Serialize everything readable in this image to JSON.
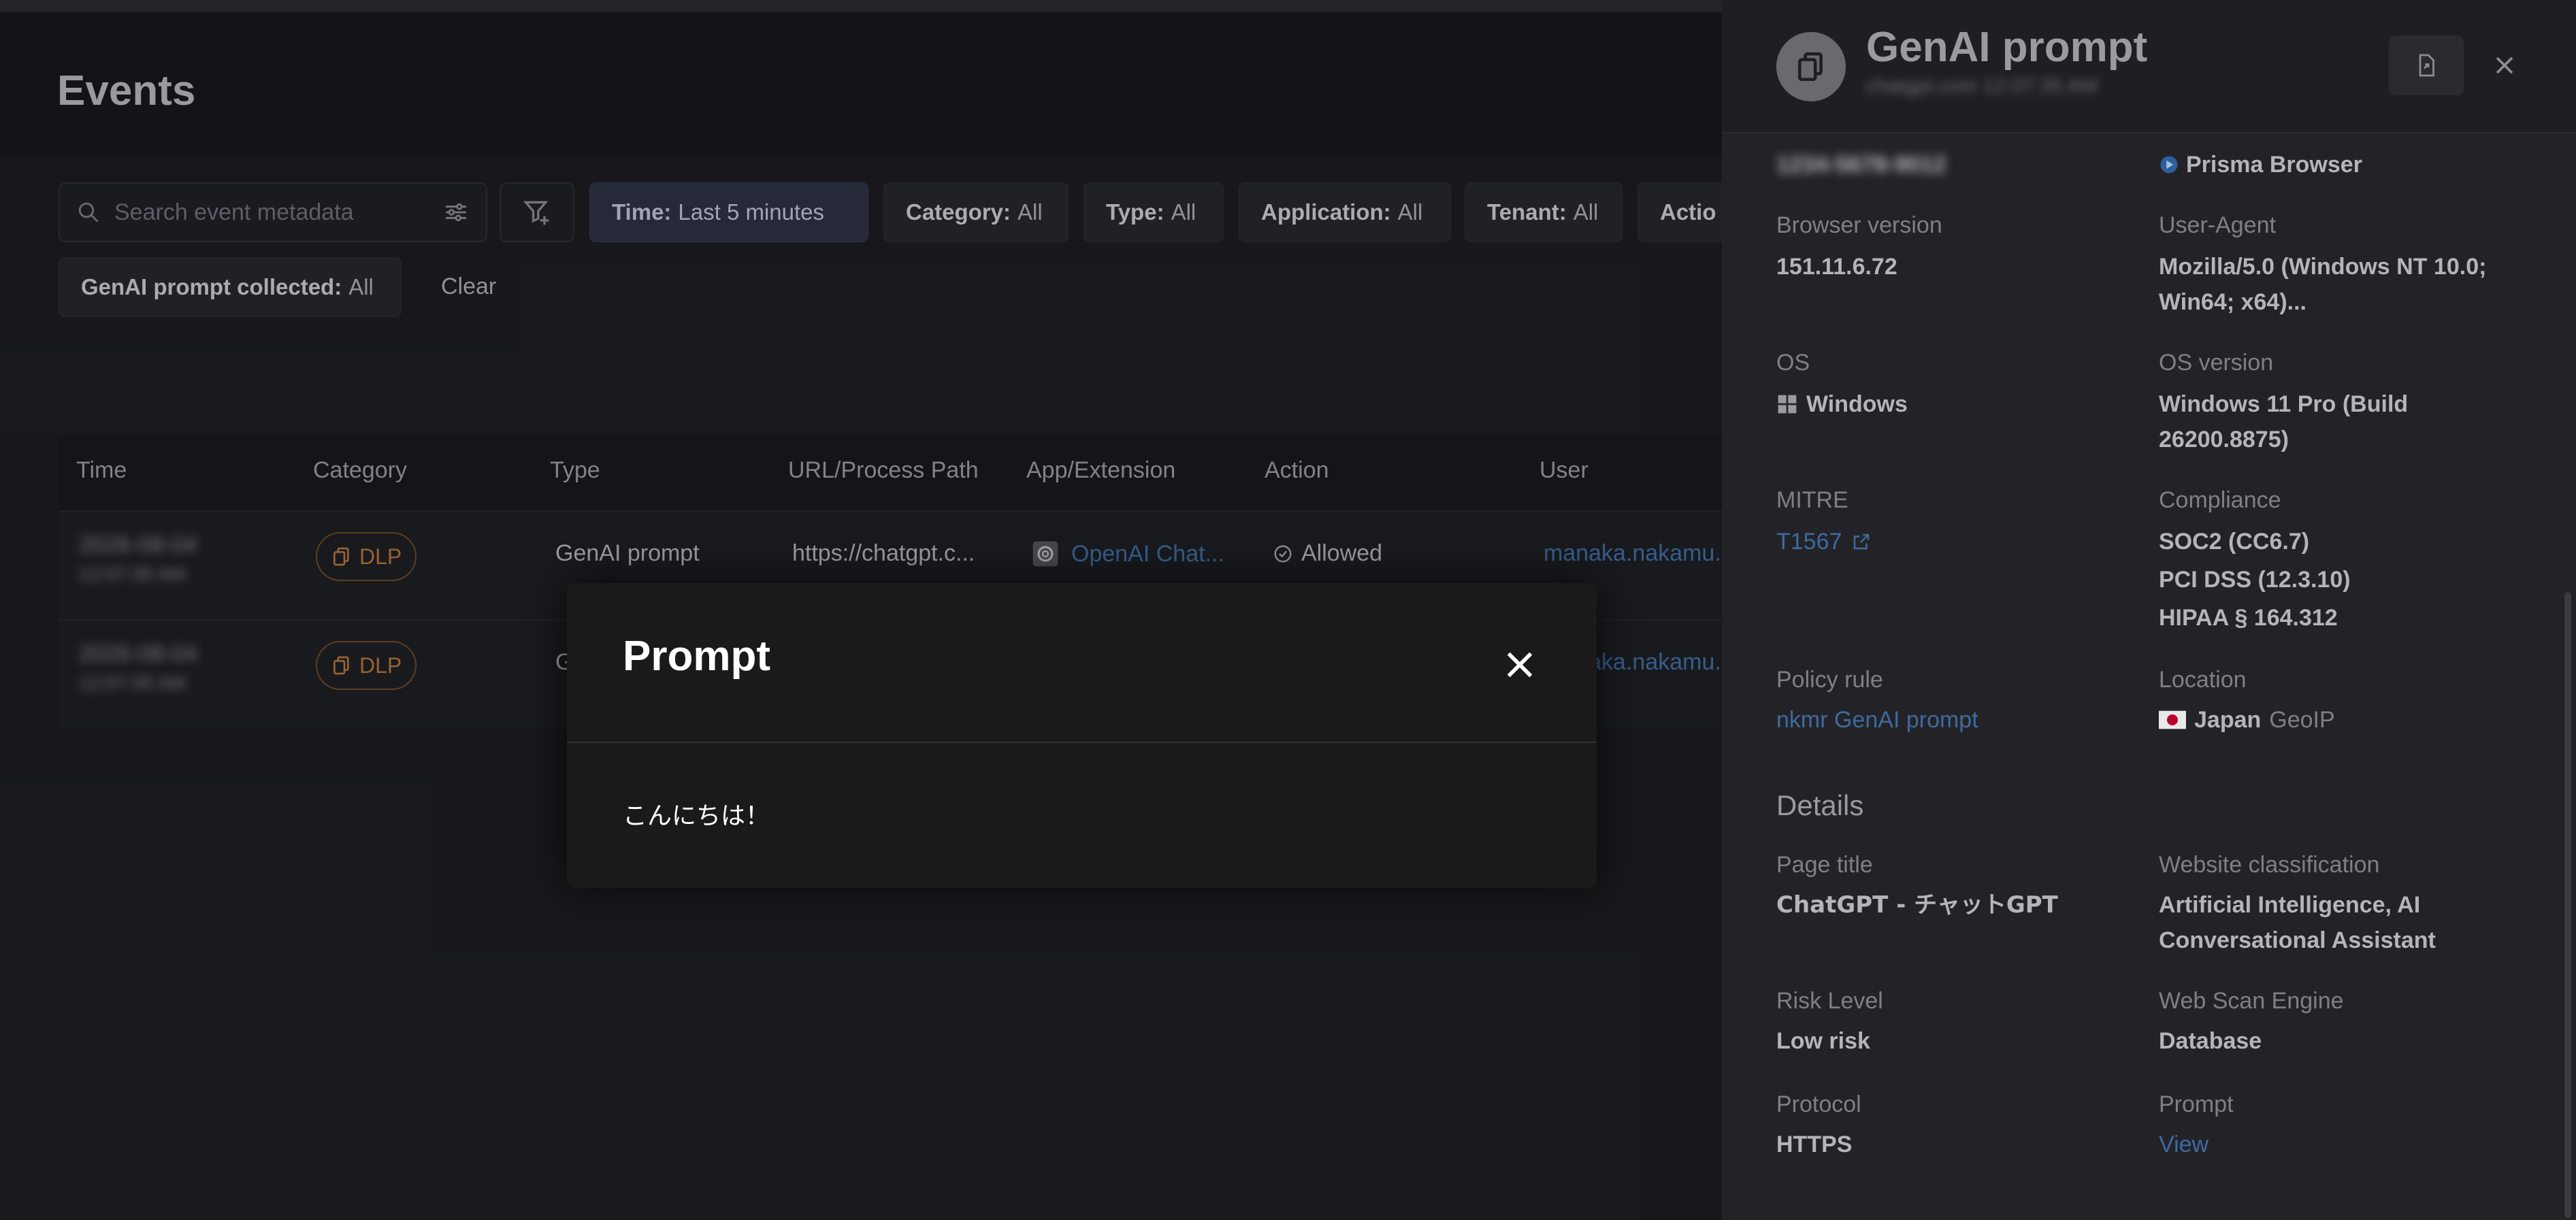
{
  "page": {
    "title": "Events"
  },
  "search": {
    "placeholder": "Search event metadata"
  },
  "filters": {
    "time": {
      "key": "Time:",
      "value": "Last 5 minutes"
    },
    "category": {
      "key": "Category:",
      "value": "All"
    },
    "type": {
      "key": "Type:",
      "value": "All"
    },
    "application": {
      "key": "Application:",
      "value": "All"
    },
    "tenant": {
      "key": "Tenant:",
      "value": "All"
    },
    "action": {
      "key": "Actio"
    },
    "genai": {
      "key": "GenAI prompt collected:",
      "value": "All"
    },
    "clear_label": "Clear"
  },
  "table": {
    "columns": [
      "Time",
      "Category",
      "Type",
      "URL/Process Path",
      "App/Extension",
      "Action",
      "User"
    ],
    "rows": [
      {
        "time": "2026-08-04",
        "time2": "12:07:35 AM",
        "category": "DLP",
        "type": "GenAI prompt",
        "url": "https://chatgpt.c...",
        "app": "OpenAI Chat...",
        "action": "Allowed",
        "user": "manaka.nakamu..."
      },
      {
        "time": "2026-08-04",
        "time2": "12:07:35 AM",
        "category": "DLP",
        "type": "G",
        "user": "manaka.nakamu..."
      }
    ]
  },
  "modal": {
    "title": "Prompt",
    "body": "こんにちは！"
  },
  "panel": {
    "title": "GenAI prompt",
    "subtitle": "chatgpt.com 12:07:35 AM",
    "top_left_blurred": "1234-5678-9012",
    "browser": "Prisma Browser",
    "fields": {
      "browser_version": {
        "label": "Browser version",
        "value": "151.11.6.72"
      },
      "user_agent": {
        "label": "User-Agent",
        "value1": "Mozilla/5.0 (Windows NT 10.0;",
        "value2": "Win64; x64)..."
      },
      "os": {
        "label": "OS",
        "value": "Windows"
      },
      "os_version": {
        "label": "OS version",
        "value1": "Windows 11 Pro (Build",
        "value2": "26200.8875)"
      },
      "mitre": {
        "label": "MITRE",
        "value": "T1567"
      },
      "compliance": {
        "label": "Compliance",
        "v1": "SOC2 (CC6.7)",
        "v2": "PCI DSS (12.3.10)",
        "v3": "HIPAA § 164.312"
      },
      "policy_rule": {
        "label": "Policy rule",
        "value": "nkmr GenAI prompt"
      },
      "location": {
        "label": "Location",
        "value": "Japan",
        "suffix": "GeoIP"
      }
    },
    "details_heading": "Details",
    "details": {
      "page_title": {
        "label": "Page title",
        "value": "ChatGPT - チャットGPT"
      },
      "website_class": {
        "label": "Website classification",
        "value1": "Artificial Intelligence, AI",
        "value2": "Conversational Assistant"
      },
      "risk": {
        "label": "Risk Level",
        "value": "Low risk"
      },
      "scan_engine": {
        "label": "Web Scan Engine",
        "value": "Database"
      },
      "protocol": {
        "label": "Protocol",
        "value": "HTTPS"
      },
      "prompt": {
        "label": "Prompt",
        "value": "View"
      }
    }
  },
  "colors": {
    "accent_link": "#3e6aa0",
    "dlp": "#b7773d",
    "modal_bg": "#1a1a1a"
  }
}
